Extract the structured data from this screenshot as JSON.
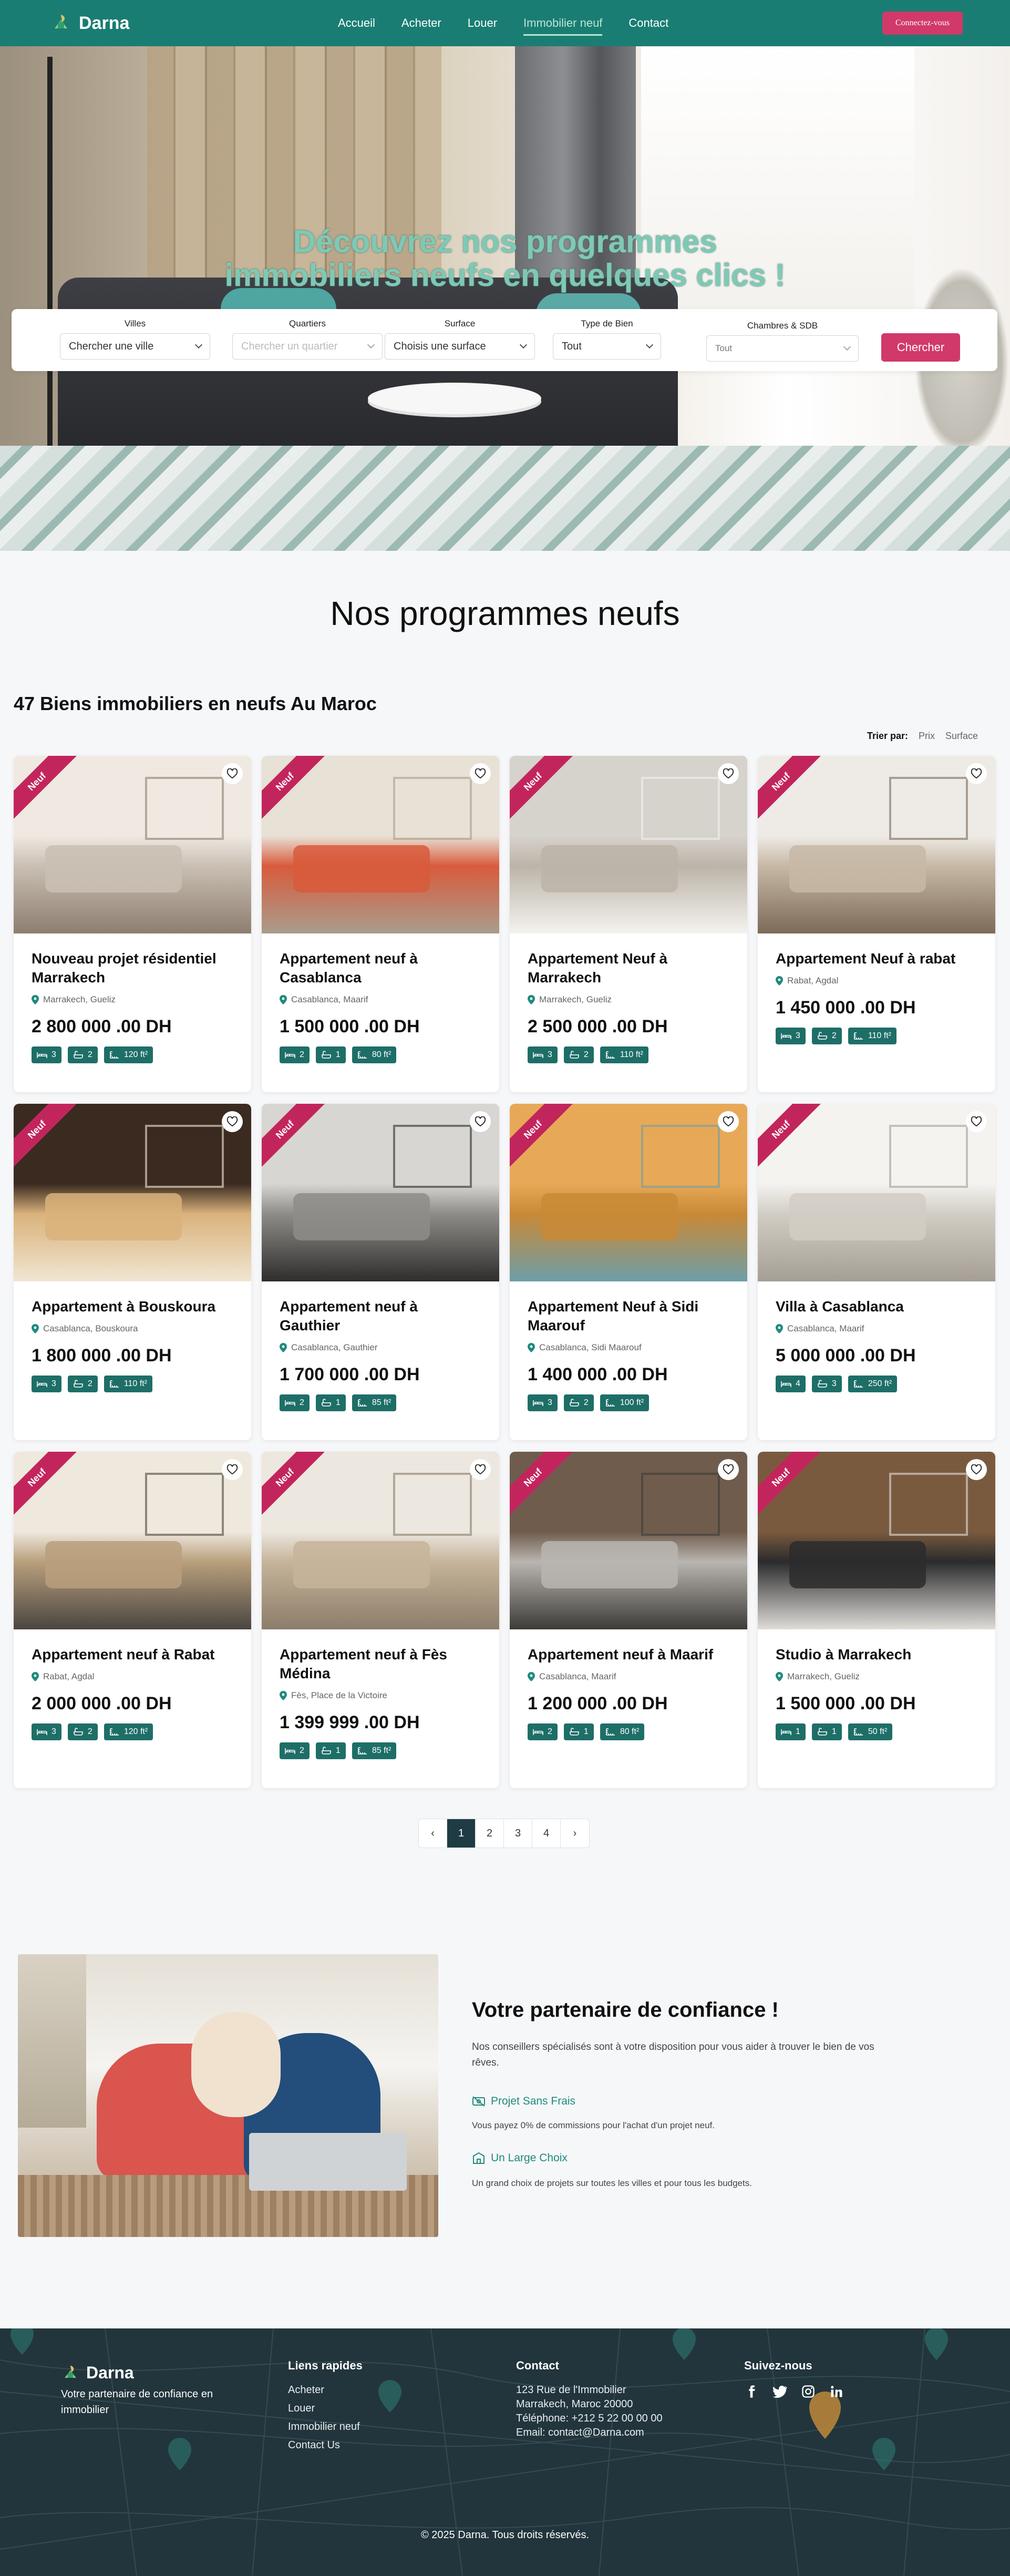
{
  "nav": {
    "brand": "Darna",
    "links": [
      "Accueil",
      "Acheter",
      "Louer",
      "Immobilier neuf",
      "Contact"
    ],
    "active_index": 3,
    "login_label": "Connectez-vous"
  },
  "hero": {
    "title_line1": "Découvrez nos programmes",
    "title_line2": "immobiliers neufs en quelques clics !"
  },
  "search": {
    "fields": [
      {
        "label": "Villes",
        "value": "Chercher une ville",
        "placeholder": false
      },
      {
        "label": "Quartiers",
        "value": "Chercher un quartier",
        "placeholder": true
      },
      {
        "label": "Surface",
        "value": "Choisis une surface",
        "placeholder": false
      },
      {
        "label": "Type de Bien",
        "value": "Tout",
        "placeholder": false
      },
      {
        "label": "Chambres & SDB",
        "value": "Tout",
        "placeholder": false
      }
    ],
    "button_label": "Chercher"
  },
  "listing": {
    "section_title": "Nos programmes neufs",
    "count_title": "47 Biens immobiliers en neufs Au Maroc",
    "sort_label": "Trier par:",
    "sort_options": [
      "Prix",
      "Surface"
    ],
    "ribbon_label": "Neuf",
    "cards": [
      {
        "title": "Nouveau projet résidentiel Marrakech",
        "location": "Marrakech, Gueliz",
        "price": "2 800 000 .00 DH",
        "beds": "3",
        "baths": "2",
        "area": "120 ft²",
        "palette": [
          "#efe9e2",
          "#c9bfb3",
          "#8d7e6f"
        ]
      },
      {
        "title": "Appartement neuf à Casablanca",
        "location": "Casablanca, Maarif",
        "price": "1 500 000 .00 DH",
        "beds": "2",
        "baths": "1",
        "area": "80 ft²",
        "palette": [
          "#e8e1d6",
          "#d85b3c",
          "#a89d8c"
        ]
      },
      {
        "title": "Appartement Neuf à Marrakech",
        "location": "Marrakech, Gueliz",
        "price": "2 500 000 .00 DH",
        "beds": "3",
        "baths": "2",
        "area": "110 ft²",
        "palette": [
          "#d6d2cc",
          "#bcb4a8",
          "#f4f2ef"
        ]
      },
      {
        "title": "Appartement Neuf à rabat",
        "location": "Rabat, Agdal",
        "price": "1 450 000 .00 DH",
        "beds": "3",
        "baths": "2",
        "area": "110 ft²",
        "palette": [
          "#eeebe6",
          "#c7b8a6",
          "#7d6a58"
        ]
      },
      {
        "title": "Appartement à Bouskoura",
        "location": "Casablanca, Bouskoura",
        "price": "1 800 000 .00 DH",
        "beds": "3",
        "baths": "2",
        "area": "110 ft²",
        "palette": [
          "#3a2a20",
          "#d9b27b",
          "#f1e6d2"
        ]
      },
      {
        "title": "Appartement neuf à Gauthier",
        "location": "Casablanca, Gauthier",
        "price": "1 700 000 .00 DH",
        "beds": "2",
        "baths": "1",
        "area": "85 ft²",
        "palette": [
          "#d8d6d2",
          "#8e8c88",
          "#2e2d2c"
        ]
      },
      {
        "title": "Appartement Neuf à Sidi Maarouf",
        "location": "Casablanca, Sidi Maarouf",
        "price": "1 400 000 .00 DH",
        "beds": "3",
        "baths": "2",
        "area": "100 ft²",
        "palette": [
          "#e7a957",
          "#c98936",
          "#6d9ea8"
        ]
      },
      {
        "title": "Villa à Casablanca",
        "location": "Casablanca, Maarif",
        "price": "5 000 000 .00 DH",
        "beds": "4",
        "baths": "3",
        "area": "250 ft²",
        "palette": [
          "#f4f3f0",
          "#d2cdc4",
          "#a49e95"
        ]
      },
      {
        "title": "Appartement neuf à Rabat",
        "location": "Rabat, Agdal",
        "price": "2 000 000 .00 DH",
        "beds": "3",
        "baths": "2",
        "area": "120 ft²",
        "palette": [
          "#efe8dd",
          "#b89f7c",
          "#4a4541"
        ]
      },
      {
        "title": "Appartement neuf à Fès Médina",
        "location": "Fès, Place de la Victoire",
        "price": "1 399 999 .00 DH",
        "beds": "2",
        "baths": "1",
        "area": "85 ft²",
        "palette": [
          "#ece7df",
          "#c6b49a",
          "#8c7d6a"
        ]
      },
      {
        "title": "Appartement neuf à Maarif",
        "location": "Casablanca, Maarif",
        "price": "1 200 000 .00 DH",
        "beds": "2",
        "baths": "1",
        "area": "80 ft²",
        "palette": [
          "#6f5c4c",
          "#b9b5b0",
          "#3d3b38"
        ]
      },
      {
        "title": "Studio à Marrakech",
        "location": "Marrakech, Gueliz",
        "price": "1 500 000 .00 DH",
        "beds": "1",
        "baths": "1",
        "area": "50 ft²",
        "palette": [
          "#7a5a3f",
          "#2b2b2d",
          "#e0ddd8"
        ]
      }
    ]
  },
  "pagination": {
    "pages": [
      "1",
      "2",
      "3",
      "4"
    ],
    "active": "1"
  },
  "partner": {
    "title": "Votre partenaire de confiance !",
    "text": "Nos conseillers spécialisés sont à votre disposition pour vous aider à trouver le bien de vos rêves.",
    "features": [
      {
        "title": "Projet Sans Frais",
        "desc": "Vous payez 0% de commissions pour l'achat d'un projet neuf."
      },
      {
        "title": "Un Large Choix",
        "desc": "Un grand choix de projets sur toutes les villes et pour tous les budgets."
      }
    ]
  },
  "footer": {
    "brand": "Darna",
    "tagline": "Votre partenaire de confiance en immobilier",
    "quick_links_title": "Liens rapides",
    "quick_links": [
      "Acheter",
      "Louer",
      "Immobilier neuf",
      "Contact Us"
    ],
    "contact_title": "Contact",
    "contact_lines": [
      "123 Rue de l'Immobilier",
      "Marrakech, Maroc 20000",
      "Téléphone: +212 5 22 00 00 00",
      "Email: contact@Darna.com"
    ],
    "social_title": "Suivez-nous",
    "social_icons": [
      "facebook-icon",
      "twitter-icon",
      "instagram-icon",
      "linkedin-icon"
    ],
    "copyright": "© 2025 Darna. Tous droits réservés."
  },
  "colors": {
    "primary": "#1a7d73",
    "accent": "#d1396a",
    "badge": "#1e6e68",
    "footer": "#22353c",
    "ribbon": "#c2255c"
  }
}
